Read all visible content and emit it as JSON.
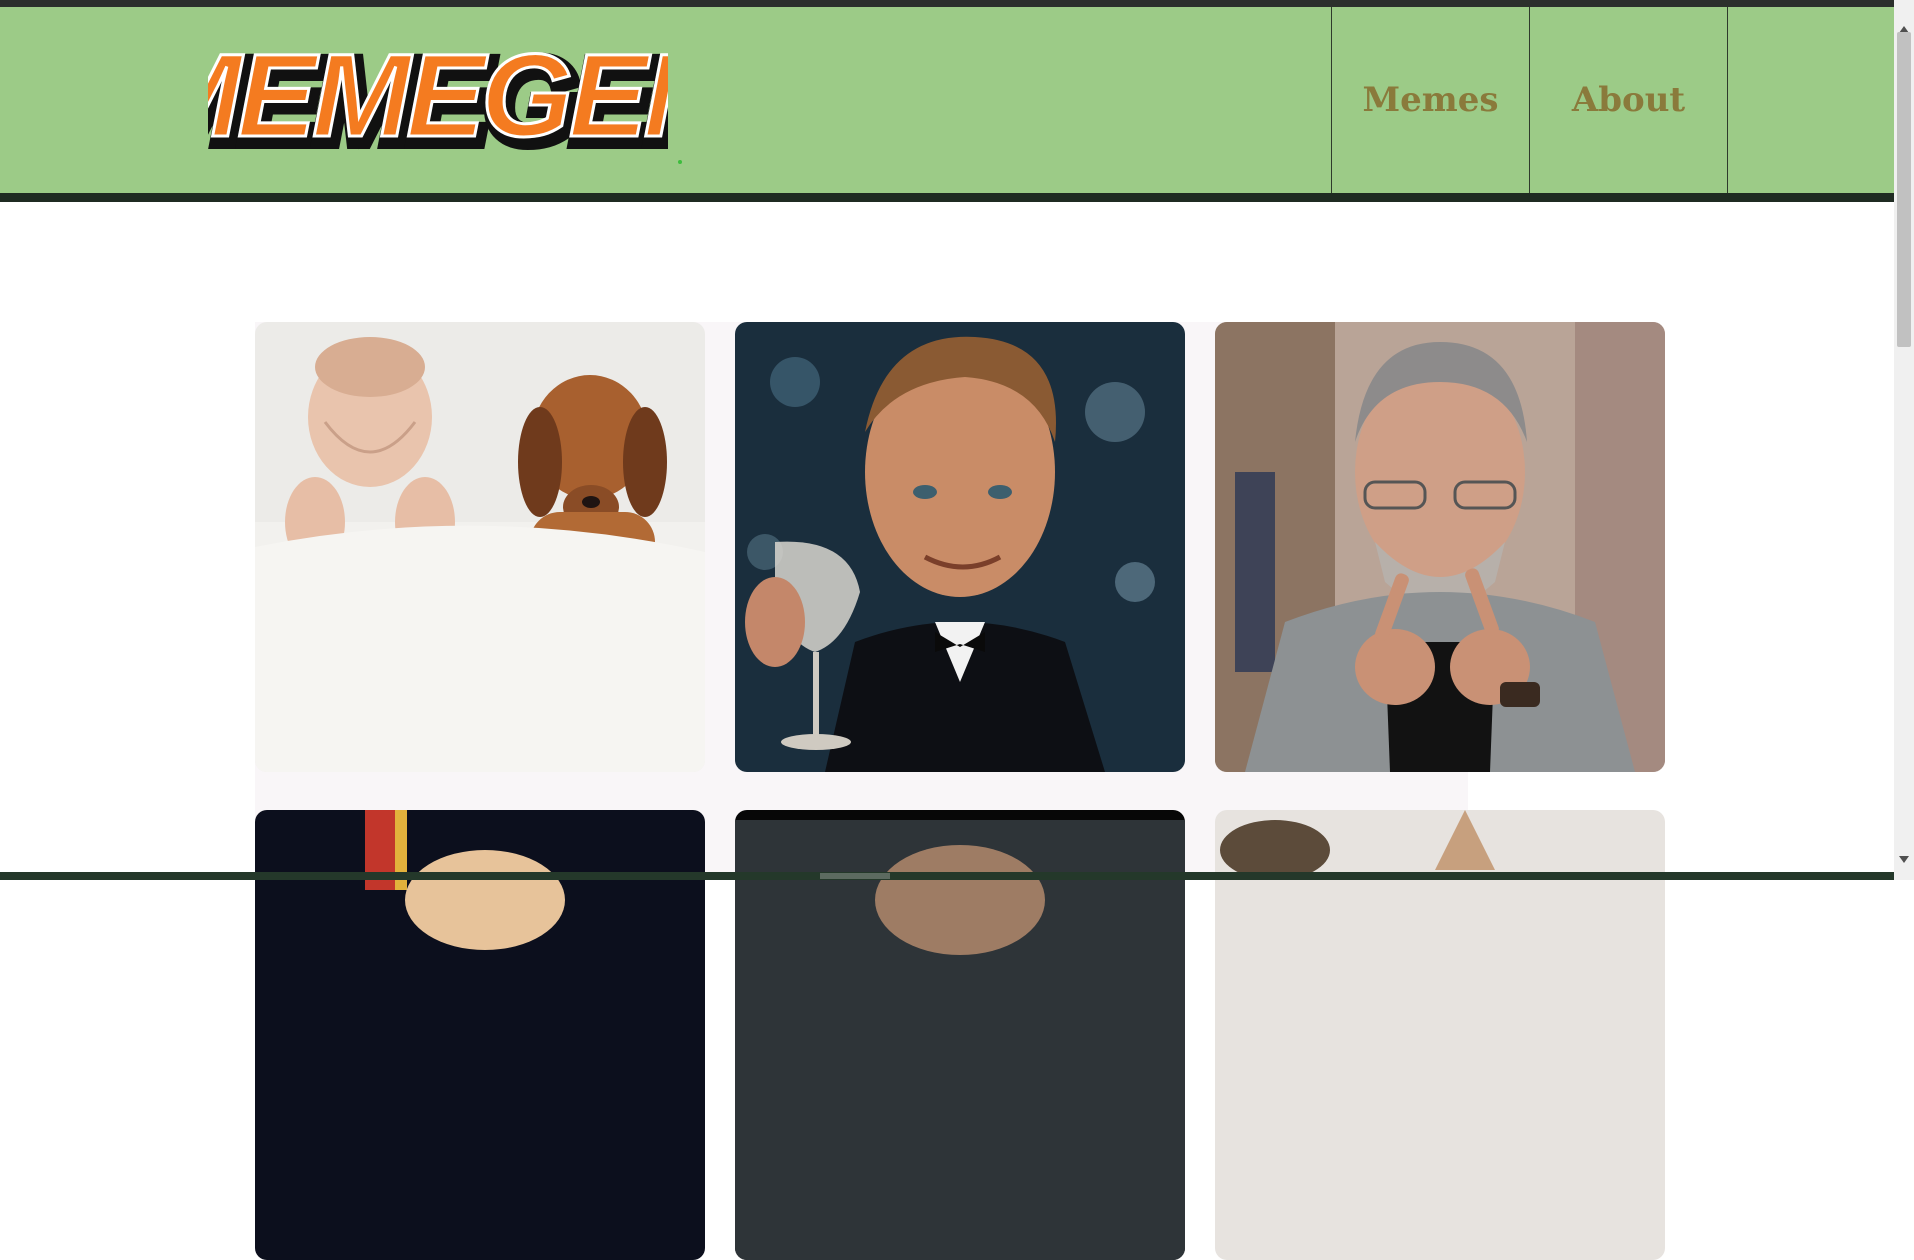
{
  "header": {
    "logo_text": "MEMEGEN",
    "nav": [
      {
        "label": "Memes"
      },
      {
        "label": "About"
      }
    ]
  },
  "gallery": {
    "cards": [
      {
        "subject": "sleeping baby and puppy"
      },
      {
        "subject": "man in tuxedo raising a glass"
      },
      {
        "subject": "man pointing with both hands"
      },
      {
        "subject": "partial meme image"
      },
      {
        "subject": "partial meme image"
      },
      {
        "subject": "partial cat image"
      }
    ]
  },
  "colors": {
    "header_bg": "#9ccb87",
    "header_border": "#1f2b22",
    "nav_text": "#8a7a3b",
    "logo_fill": "#f47b20",
    "logo_outline": "#111111"
  },
  "icons": [
    "scroll-up-arrow-icon",
    "scroll-down-arrow-icon"
  ]
}
